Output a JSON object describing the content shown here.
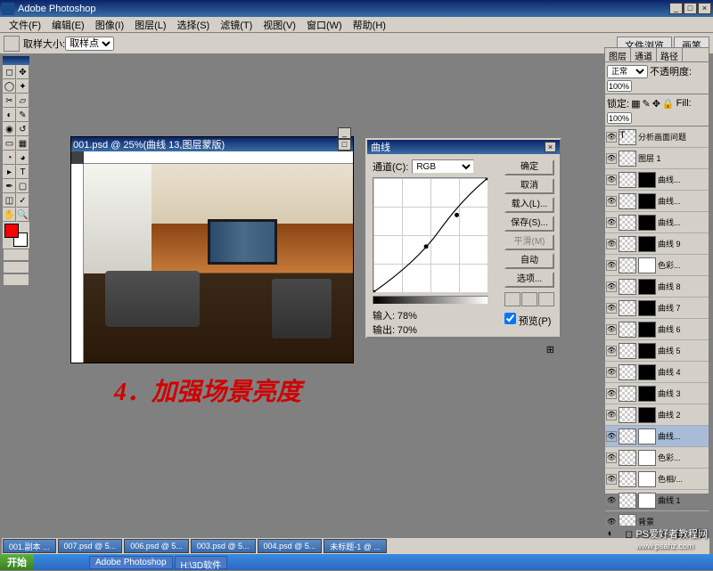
{
  "app": {
    "title": "Adobe Photoshop"
  },
  "menu": [
    "文件(F)",
    "编辑(E)",
    "图像(I)",
    "图层(L)",
    "选择(S)",
    "滤镜(T)",
    "视图(V)",
    "窗口(W)",
    "帮助(H)"
  ],
  "optionsbar": {
    "label": "取样大小:",
    "sample": "取样点",
    "tabs": [
      "文件浏览",
      "画笔"
    ]
  },
  "doc": {
    "title": "001.psd @ 25%(曲线 13,图层蒙版)"
  },
  "curves": {
    "title": "曲线",
    "channel_label": "通道(C):",
    "channel": "RGB",
    "input_label": "输入:",
    "input_value": "78%",
    "output_label": "输出:",
    "output_value": "70%",
    "btns": {
      "ok": "确定",
      "cancel": "取消",
      "load": "载入(L)...",
      "save": "保存(S)...",
      "smooth": "平滑(M)",
      "auto": "自动",
      "options": "选项..."
    },
    "preview": "预览(P)"
  },
  "layers_panel": {
    "tabs": [
      "图层",
      "通道",
      "路径"
    ],
    "blend": "正常",
    "opacity_label": "不透明度:",
    "opacity": "100%",
    "lock_label": "锁定:",
    "fill_label": "Fill:",
    "fill": "100%",
    "items": [
      {
        "name": "分析画面问题",
        "type": "T"
      },
      {
        "name": "图层 1",
        "type": "img"
      },
      {
        "name": "曲线...",
        "type": "adj",
        "mask": "blk"
      },
      {
        "name": "曲线...",
        "type": "adj",
        "mask": "blk"
      },
      {
        "name": "曲线...",
        "type": "adj",
        "mask": "blk"
      },
      {
        "name": "曲线 9",
        "type": "adj",
        "mask": "blk"
      },
      {
        "name": "色彩...",
        "type": "adj",
        "mask": "wht"
      },
      {
        "name": "曲线 8",
        "type": "adj",
        "mask": "blk"
      },
      {
        "name": "曲线 7",
        "type": "adj",
        "mask": "blk"
      },
      {
        "name": "曲线 6",
        "type": "adj",
        "mask": "blk"
      },
      {
        "name": "曲线 5",
        "type": "adj",
        "mask": "blk"
      },
      {
        "name": "曲线 4",
        "type": "adj",
        "mask": "blk"
      },
      {
        "name": "曲线 3",
        "type": "adj",
        "mask": "blk"
      },
      {
        "name": "曲线 2",
        "type": "adj",
        "mask": "blk"
      },
      {
        "name": "曲线...",
        "type": "adj",
        "mask": "wht",
        "sel": true
      },
      {
        "name": "色彩...",
        "type": "adj",
        "mask": "wht"
      },
      {
        "name": "色相/...",
        "type": "adj",
        "mask": "wht"
      },
      {
        "name": "曲线 1",
        "type": "adj",
        "mask": "wht"
      },
      {
        "name": "背景",
        "type": "img"
      }
    ]
  },
  "annotation": "4．加强场景亮度",
  "doctabs": [
    "001.副本 ...",
    "007.psd @ 5...",
    "006.psd @ 5...",
    "003.psd @ 5...",
    "004.psd @ 5...",
    "未标题-1 @ ..."
  ],
  "taskbar": {
    "start": "开始",
    "items": [
      "Adobe Photoshop",
      "H:\\3D软件"
    ]
  },
  "watermark": {
    "line1": "PS爱好者教程网",
    "line2": "www.psahz.com"
  }
}
